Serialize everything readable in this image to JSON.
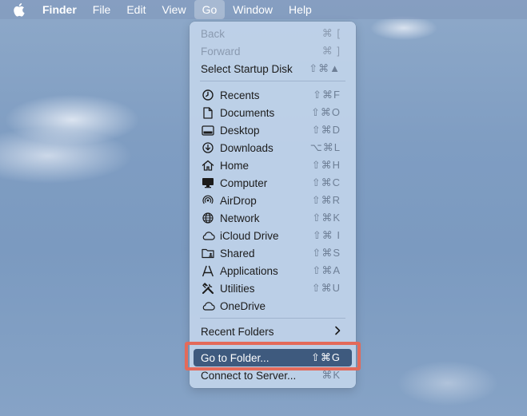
{
  "menubar": {
    "apple_icon": "apple-logo-icon",
    "app_name": "Finder",
    "items": [
      "File",
      "Edit",
      "View",
      "Go",
      "Window",
      "Help"
    ]
  },
  "go_menu": {
    "nav": [
      {
        "label": "Back",
        "shortcut": "⌘ [",
        "enabled": false
      },
      {
        "label": "Forward",
        "shortcut": "⌘ ]",
        "enabled": false
      },
      {
        "label": "Select Startup Disk",
        "shortcut": "⇧⌘▲",
        "enabled": true
      }
    ],
    "places": [
      {
        "label": "Recents",
        "shortcut": "⇧⌘F",
        "icon": "clock-icon"
      },
      {
        "label": "Documents",
        "shortcut": "⇧⌘O",
        "icon": "document-icon"
      },
      {
        "label": "Desktop",
        "shortcut": "⇧⌘D",
        "icon": "desktop-icon"
      },
      {
        "label": "Downloads",
        "shortcut": "⌥⌘L",
        "icon": "download-icon"
      },
      {
        "label": "Home",
        "shortcut": "⇧⌘H",
        "icon": "home-icon"
      },
      {
        "label": "Computer",
        "shortcut": "⇧⌘C",
        "icon": "computer-icon"
      },
      {
        "label": "AirDrop",
        "shortcut": "⇧⌘R",
        "icon": "airdrop-icon"
      },
      {
        "label": "Network",
        "shortcut": "⇧⌘K",
        "icon": "globe-icon"
      },
      {
        "label": "iCloud Drive",
        "shortcut": "⇧⌘ I",
        "icon": "cloud-icon"
      },
      {
        "label": "Shared",
        "shortcut": "⇧⌘S",
        "icon": "shared-folder-icon"
      },
      {
        "label": "Applications",
        "shortcut": "⇧⌘A",
        "icon": "applications-icon"
      },
      {
        "label": "Utilities",
        "shortcut": "⇧⌘U",
        "icon": "tools-icon"
      },
      {
        "label": "OneDrive",
        "shortcut": "",
        "icon": "cloud-icon"
      }
    ],
    "recent_folders": {
      "label": "Recent Folders",
      "icon": "chevron-right-icon"
    },
    "go_to_folder": {
      "label": "Go to Folder...",
      "shortcut": "⇧⌘G"
    },
    "connect_to_server": {
      "label": "Connect to Server...",
      "shortcut": "⌘K"
    }
  },
  "colors": {
    "highlight": "#3e5a7e",
    "callout_border": "#e36a5a"
  }
}
